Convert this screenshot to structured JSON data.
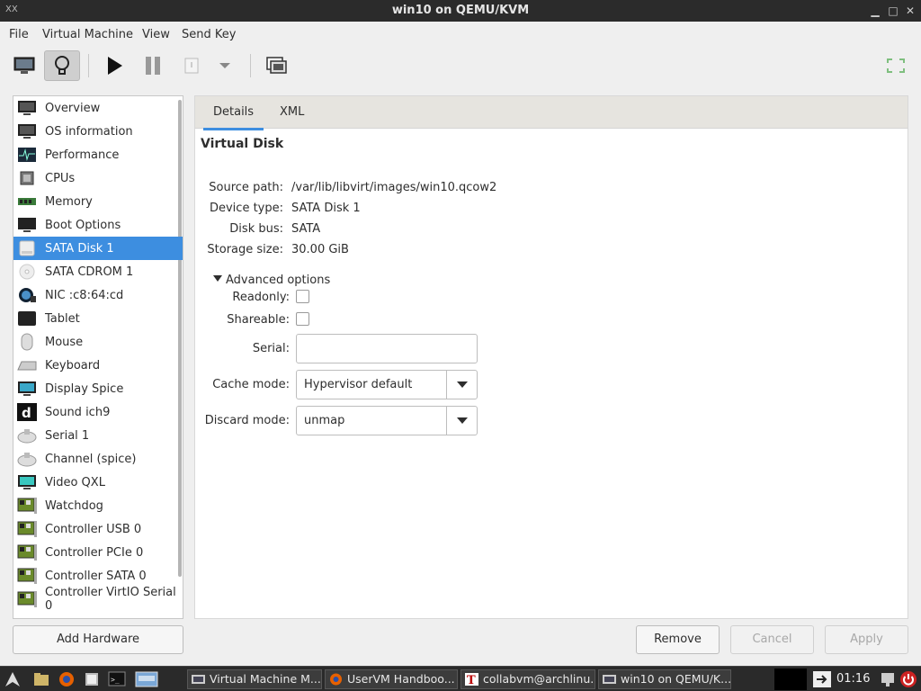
{
  "window": {
    "title": "win10 on QEMU/KVM"
  },
  "menu": [
    "File",
    "Virtual Machine",
    "View",
    "Send Key"
  ],
  "sidebar": {
    "selected": 6,
    "items": [
      {
        "label": "Overview",
        "icon": "monitor-icon"
      },
      {
        "label": "OS information",
        "icon": "monitor-icon"
      },
      {
        "label": "Performance",
        "icon": "performance-icon"
      },
      {
        "label": "CPUs",
        "icon": "cpu-icon"
      },
      {
        "label": "Memory",
        "icon": "memory-icon"
      },
      {
        "label": "Boot Options",
        "icon": "boot-icon"
      },
      {
        "label": "SATA Disk 1",
        "icon": "disk-icon"
      },
      {
        "label": "SATA CDROM 1",
        "icon": "cdrom-icon"
      },
      {
        "label": "NIC :c8:64:cd",
        "icon": "nic-icon"
      },
      {
        "label": "Tablet",
        "icon": "tablet-icon"
      },
      {
        "label": "Mouse",
        "icon": "mouse-icon"
      },
      {
        "label": "Keyboard",
        "icon": "keyboard-icon"
      },
      {
        "label": "Display Spice",
        "icon": "display-icon"
      },
      {
        "label": "Sound ich9",
        "icon": "sound-icon"
      },
      {
        "label": "Serial 1",
        "icon": "serial-icon"
      },
      {
        "label": "Channel (spice)",
        "icon": "channel-icon"
      },
      {
        "label": "Video QXL",
        "icon": "video-icon"
      },
      {
        "label": "Watchdog",
        "icon": "card-icon"
      },
      {
        "label": "Controller USB 0",
        "icon": "card-icon"
      },
      {
        "label": "Controller PCIe 0",
        "icon": "card-icon"
      },
      {
        "label": "Controller SATA 0",
        "icon": "card-icon"
      },
      {
        "label": "Controller VirtIO Serial 0",
        "icon": "card-icon"
      }
    ],
    "add_hardware": "Add Hardware"
  },
  "tabs": [
    "Details",
    "XML"
  ],
  "details": {
    "section_title": "Virtual Disk",
    "source_path_label": "Source path:",
    "source_path": "/var/lib/libvirt/images/win10.qcow2",
    "device_type_label": "Device type:",
    "device_type": "SATA Disk 1",
    "disk_bus_label": "Disk bus:",
    "disk_bus": "SATA",
    "storage_size_label": "Storage size:",
    "storage_size": "30.00 GiB",
    "advanced_label": "Advanced options",
    "readonly_label": "Readonly:",
    "shareable_label": "Shareable:",
    "serial_label": "Serial:",
    "serial_value": "",
    "cache_mode_label": "Cache mode:",
    "cache_mode": "Hypervisor default",
    "discard_mode_label": "Discard mode:",
    "discard_mode": "unmap"
  },
  "buttons": {
    "remove": "Remove",
    "cancel": "Cancel",
    "apply": "Apply"
  },
  "taskbar": {
    "tasks": [
      "Virtual Machine M...",
      "UserVM Handboo...",
      "collabvm@archlinu...",
      "win10 on QEMU/K..."
    ],
    "clock": "01:16"
  },
  "colors": {
    "selection": "#3d8ee0",
    "titlebar": "#2b2b2b",
    "taskbar": "#2a2a2a"
  }
}
